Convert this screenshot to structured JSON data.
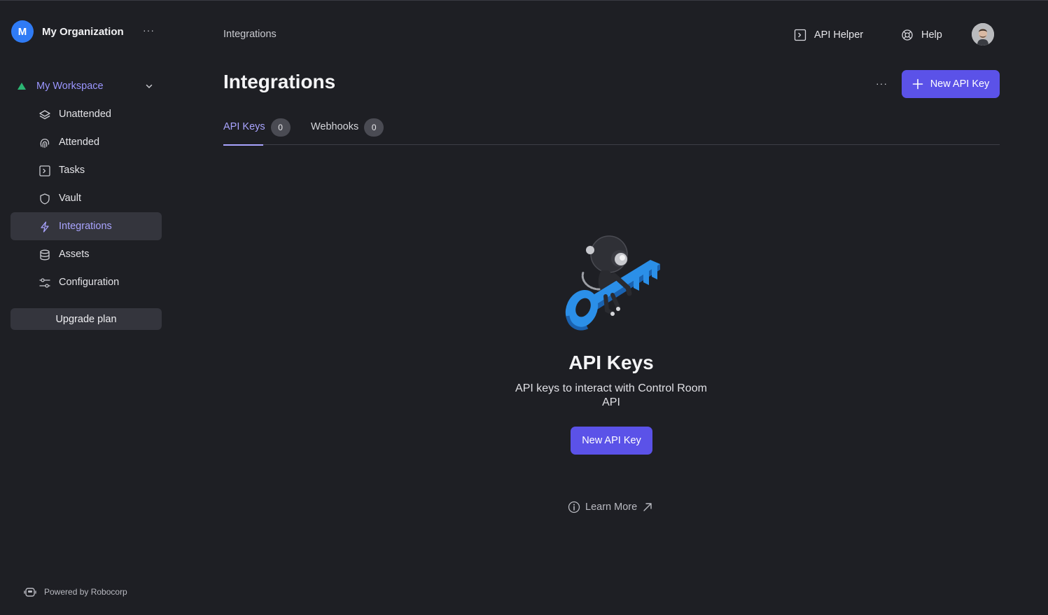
{
  "org": {
    "initial": "M",
    "name": "My Organization",
    "more": "···"
  },
  "workspace": {
    "name": "My Workspace"
  },
  "nav": [
    {
      "label": "Unattended",
      "icon": "layers-icon"
    },
    {
      "label": "Attended",
      "icon": "fingerprint-icon"
    },
    {
      "label": "Tasks",
      "icon": "terminal-icon"
    },
    {
      "label": "Vault",
      "icon": "shield-icon"
    },
    {
      "label": "Integrations",
      "icon": "lightning-icon",
      "active": true
    },
    {
      "label": "Assets",
      "icon": "database-icon"
    },
    {
      "label": "Configuration",
      "icon": "sliders-icon"
    }
  ],
  "upgrade_label": "Upgrade plan",
  "powered_by": "Powered by Robocorp",
  "header": {
    "breadcrumb": "Integrations",
    "api_helper": "API Helper",
    "help": "Help"
  },
  "page": {
    "title": "Integrations",
    "more": "···",
    "new_key_label": "New API Key"
  },
  "tabs": [
    {
      "label": "API Keys",
      "count": "0",
      "active": true
    },
    {
      "label": "Webhooks",
      "count": "0",
      "active": false
    }
  ],
  "empty_state": {
    "title": "API Keys",
    "description": "API keys to interact with Control Room API",
    "button_label": "New API Key",
    "learn_more": "Learn More"
  },
  "colors": {
    "background": "#1e1f24",
    "accent": "#5b52e8",
    "active_text": "#a9a4ff",
    "workspace_marker": "#2bb673",
    "org_avatar": "#2f7bf5",
    "key_blue": "#2b8fe8"
  }
}
